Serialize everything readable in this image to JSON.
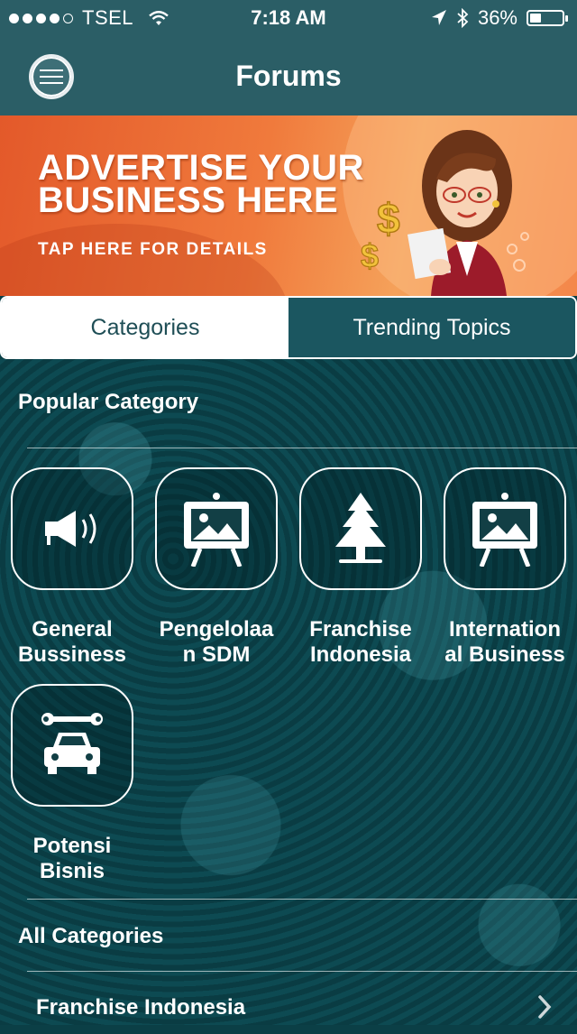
{
  "status_bar": {
    "carrier": "TSEL",
    "time": "7:18 AM",
    "battery_text": "36%",
    "battery_level": 0.36
  },
  "navbar": {
    "title": "Forums",
    "menu_icon": "hamburger-menu-icon"
  },
  "banner": {
    "headline_line1": "ADVERTISE YOUR",
    "headline_line2": "BUSINESS HERE",
    "tap_text": "TAP HERE FOR DETAILS"
  },
  "tabs": [
    {
      "label": "Categories",
      "active": true
    },
    {
      "label": "Trending Topics",
      "active": false
    }
  ],
  "popular": {
    "title": "Popular Category",
    "items": [
      {
        "line1": "General",
        "line2": "Bussiness",
        "icon": "megaphone-icon"
      },
      {
        "line1": "Pengelolaa",
        "line2": "n SDM",
        "icon": "easel-picture-icon"
      },
      {
        "line1": "Franchise",
        "line2": "Indonesia",
        "icon": "pine-tree-icon"
      },
      {
        "line1": "Internation",
        "line2": "al Business",
        "icon": "easel-picture-icon"
      },
      {
        "line1": "Potensi",
        "line2": "Bisnis",
        "icon": "car-repair-icon"
      }
    ]
  },
  "all_categories": {
    "title": "All Categories",
    "items": [
      {
        "label": "Franchise Indonesia"
      }
    ]
  },
  "colors": {
    "nav_bg": "#2b5e66",
    "tab_active_text": "#1f4e56",
    "content_bg": "#0c434a"
  }
}
